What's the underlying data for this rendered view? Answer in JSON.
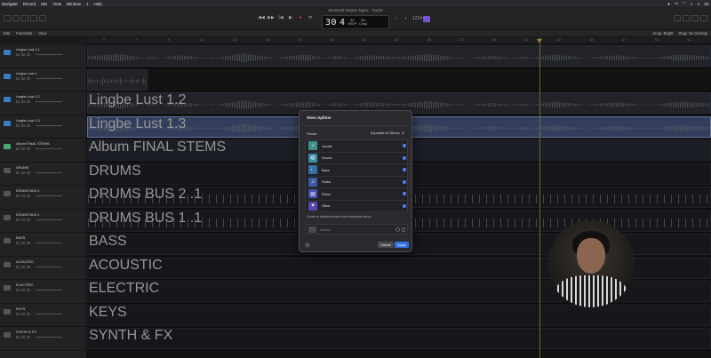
{
  "menubar": {
    "items": [
      "Navigate",
      "Record",
      "Mix",
      "View",
      "Window",
      "1",
      "Help"
    ],
    "right_time": "ZK"
  },
  "window": {
    "title": "Stemmed session.logicx - Tracks"
  },
  "lcd": {
    "bar": "30",
    "beat": "4",
    "bar_label": "BAR",
    "beat_label": "BEAT",
    "tempo": "80",
    "tempo_label": "KEEP",
    "sig": "3/4",
    "key": "Cmaj"
  },
  "editbar": {
    "edit": "Edit",
    "functions": "Functions",
    "view": "View",
    "snap": "Snap: Bright",
    "drag": "Drag: No Overlap"
  },
  "ruler": [
    "5",
    "7",
    "9",
    "11",
    "13",
    "15",
    "17",
    "19",
    "21",
    "23",
    "25",
    "27",
    "29",
    "31",
    "33",
    "35",
    "37",
    "39",
    "41"
  ],
  "tracks": [
    {
      "name": "Lingbe Lust 1.1",
      "type": "blue"
    },
    {
      "name": "Lingbe Lust 1",
      "type": "blue"
    },
    {
      "name": "Lingbe Lust 1.2",
      "type": "blue"
    },
    {
      "name": "Lingbe Lust 1.3",
      "type": "blue"
    },
    {
      "name": "Album FINAL STEMS",
      "type": "green"
    },
    {
      "name": "DRUMS",
      "type": "grey"
    },
    {
      "name": "DRUMS BUS 2",
      "type": "grey"
    },
    {
      "name": "DRUMS BUS 1",
      "type": "grey"
    },
    {
      "name": "BASS",
      "type": "grey"
    },
    {
      "name": "ACOUSTIC",
      "type": "grey"
    },
    {
      "name": "ELECTRIC",
      "type": "grey"
    },
    {
      "name": "KEYS",
      "type": "grey"
    },
    {
      "name": "SYNTH & FX",
      "type": "grey"
    }
  ],
  "regions": [
    {
      "lane": 3,
      "name": "Lingbe Lust 1.3"
    },
    {
      "lane": 2,
      "name": "Lingbe Lust 1.2"
    },
    {
      "lane": 4,
      "name": "Album FINAL STEMS"
    },
    {
      "lane": 5,
      "name": "DRUMS"
    },
    {
      "lane": 6,
      "name": "DRUMS BUS 2 .1"
    },
    {
      "lane": 7,
      "name": "DRUMS BUS 1 .1"
    },
    {
      "lane": 8,
      "name": "BASS"
    },
    {
      "lane": 9,
      "name": "ACOUSTIC"
    },
    {
      "lane": 10,
      "name": "ELECTRIC"
    },
    {
      "lane": 11,
      "name": "KEYS"
    },
    {
      "lane": 12,
      "name": "SYNTH & FX"
    }
  ],
  "dialog": {
    "title": "Stem Splitter",
    "preset_label": "Preset",
    "preset_value": "Separate All Stems",
    "stems": [
      {
        "name": "Vocals",
        "color": "#3f8f8a",
        "glyph": "♪"
      },
      {
        "name": "Drums",
        "color": "#3f8fa6",
        "glyph": "◍"
      },
      {
        "name": "Bass",
        "color": "#3a6fa6",
        "glyph": "♩"
      },
      {
        "name": "Guitar",
        "color": "#3b5aa6",
        "glyph": "♫"
      },
      {
        "name": "Piano",
        "color": "#4a4fb0",
        "glyph": "▤"
      },
      {
        "name": "Other",
        "color": "#5a48b0",
        "glyph": "✦"
      }
    ],
    "option_text": "Create an additional submix from deselected stems:",
    "submix_label": "Submix",
    "help": "?",
    "cancel": "Cancel",
    "apply": "Apply"
  },
  "colors": {
    "accent": "#2f6fe0",
    "playhead": "#c8a431"
  }
}
